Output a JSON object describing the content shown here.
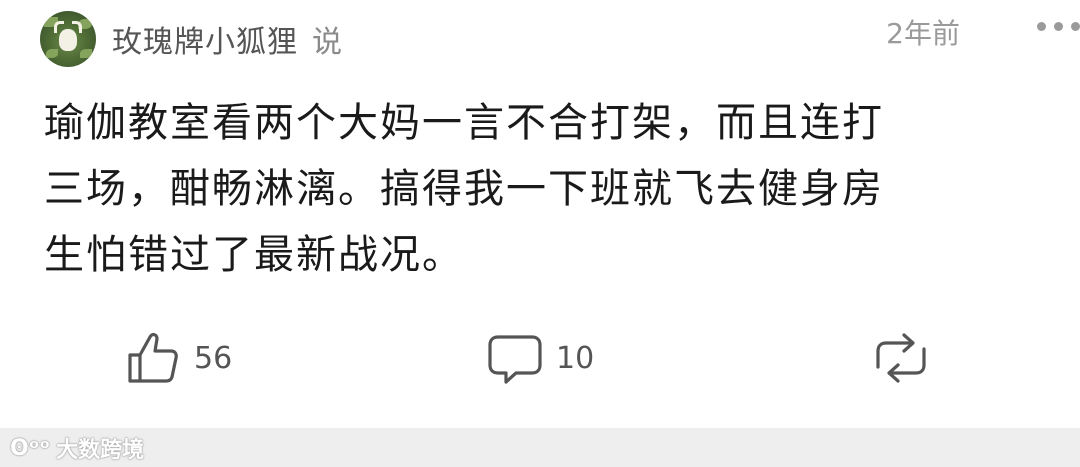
{
  "post": {
    "username": "玫瑰牌小狐狸",
    "said": "说",
    "time": "2年前",
    "content": "瑜伽教室看两个大妈一言不合打架，而且连打\n三场，酣畅淋漓。搞得我一下班就飞去健身房\n生怕错过了最新战况。"
  },
  "actions": {
    "like_count": "56",
    "comment_count": "10"
  },
  "watermark": {
    "logo": "ʘᵒᵒ",
    "text": "大数跨境"
  },
  "icons": {
    "like": "thumbs-up-icon",
    "comment": "comment-bubble-icon",
    "repost": "repost-icon",
    "more": "more-dots-icon"
  }
}
